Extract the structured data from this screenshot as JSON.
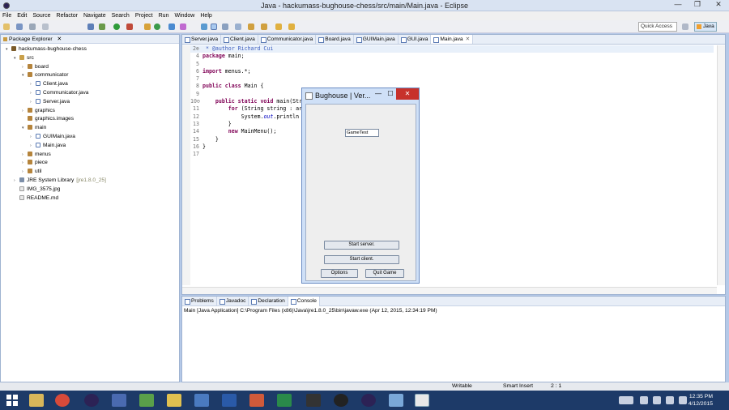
{
  "window": {
    "title": "Java - hackumass-bughouse-chess/src/main/Main.java - Eclipse",
    "min": "—",
    "max": "❐",
    "close": "✕"
  },
  "menu": [
    "File",
    "Edit",
    "Source",
    "Refactor",
    "Navigate",
    "Search",
    "Project",
    "Run",
    "Window",
    "Help"
  ],
  "toolbar": {
    "quick_access": "Quick Access",
    "perspective": "Java"
  },
  "package_explorer": {
    "title": "Package Explorer",
    "close": "✕",
    "items": [
      {
        "label": "hackumass-bughouse-chess",
        "depth": 0,
        "icon": "proj",
        "twisty": "▾"
      },
      {
        "label": "src",
        "depth": 1,
        "icon": "folder",
        "twisty": "▾"
      },
      {
        "label": "board",
        "depth": 2,
        "icon": "pkg",
        "twisty": "›"
      },
      {
        "label": "communicator",
        "depth": 2,
        "icon": "pkg",
        "twisty": "▾"
      },
      {
        "label": "Client.java",
        "depth": 3,
        "icon": "java",
        "twisty": "›"
      },
      {
        "label": "Communicator.java",
        "depth": 3,
        "icon": "java",
        "twisty": "›"
      },
      {
        "label": "Server.java",
        "depth": 3,
        "icon": "java",
        "twisty": "›"
      },
      {
        "label": "graphics",
        "depth": 2,
        "icon": "pkg",
        "twisty": "›"
      },
      {
        "label": "graphics.images",
        "depth": 2,
        "icon": "pkg",
        "twisty": ""
      },
      {
        "label": "main",
        "depth": 2,
        "icon": "pkg",
        "twisty": "▾"
      },
      {
        "label": "GUIMain.java",
        "depth": 3,
        "icon": "java",
        "twisty": "›"
      },
      {
        "label": "Main.java",
        "depth": 3,
        "icon": "java",
        "twisty": "›"
      },
      {
        "label": "menus",
        "depth": 2,
        "icon": "pkg",
        "twisty": "›"
      },
      {
        "label": "piece",
        "depth": 2,
        "icon": "pkg",
        "twisty": "›"
      },
      {
        "label": "util",
        "depth": 2,
        "icon": "pkg",
        "twisty": "›"
      },
      {
        "label": "JRE System Library",
        "suffix": "[jre1.8.0_25]",
        "depth": 1,
        "icon": "lib",
        "twisty": "›"
      },
      {
        "label": "IMG_3575.jpg",
        "depth": 1,
        "icon": "file",
        "twisty": ""
      },
      {
        "label": "README.md",
        "depth": 1,
        "icon": "file",
        "twisty": ""
      }
    ]
  },
  "editor": {
    "tabs": [
      {
        "label": "Server.java",
        "active": false
      },
      {
        "label": "Client.java",
        "active": false
      },
      {
        "label": "Communicator.java",
        "active": false
      },
      {
        "label": "Board.java",
        "active": false
      },
      {
        "label": "GUIMain.java",
        "active": false
      },
      {
        "label": "GUI.java",
        "active": false
      },
      {
        "label": "Main.java",
        "active": true,
        "close": "✕"
      }
    ],
    "lines": [
      {
        "no": "2⊕",
        "text": " * @author Richard Cui",
        "cls": "cm"
      },
      {
        "no": "4",
        "kw": "package",
        "text": " main;"
      },
      {
        "no": "5",
        "text": ""
      },
      {
        "no": "6",
        "kw": "import",
        "text": " menus.*;"
      },
      {
        "no": "7",
        "text": ""
      },
      {
        "no": "8",
        "kw": "public class",
        "text": " Main {"
      },
      {
        "no": "9",
        "text": ""
      },
      {
        "no": "10⊖",
        "kw": "    public static void",
        "text": " main(Str"
      },
      {
        "no": "11",
        "kw": "        for",
        "text": " (String string : ar"
      },
      {
        "no": "12",
        "text": "            System.",
        "fld": "out",
        "tail": ".println"
      },
      {
        "no": "13",
        "text": "        }"
      },
      {
        "no": "14",
        "kw": "        new",
        "text": " MainMenu();"
      },
      {
        "no": "15",
        "text": "    }"
      },
      {
        "no": "16",
        "text": "}"
      },
      {
        "no": "17",
        "text": ""
      }
    ]
  },
  "console": {
    "tabs": [
      "Problems",
      "Javadoc",
      "Declaration",
      "Console"
    ],
    "active_tab": "Console",
    "launch": "Main [Java Application] C:\\Program Files (x86)\\Java\\jre1.8.0_25\\bin\\javaw.exe (Apr 12, 2015, 12:34:19 PM)"
  },
  "status": {
    "writable": "Writable",
    "insert": "Smart Insert",
    "position": "2 : 1"
  },
  "swing_frame": {
    "title": "Bughouse | Ver...",
    "text_field": "GameTest",
    "start_server": "Start server.",
    "start_client": "Start client.",
    "options": "Options",
    "quit": "Quit Game",
    "min": "—",
    "max": "☐",
    "close": "✕"
  },
  "taskbar": {
    "time": "12:35 PM",
    "date": "4/12/2015"
  },
  "colors": {
    "accent": "#1d3a68",
    "frame_close": "#c7312b",
    "frame_bg": "#cfe0f7"
  }
}
